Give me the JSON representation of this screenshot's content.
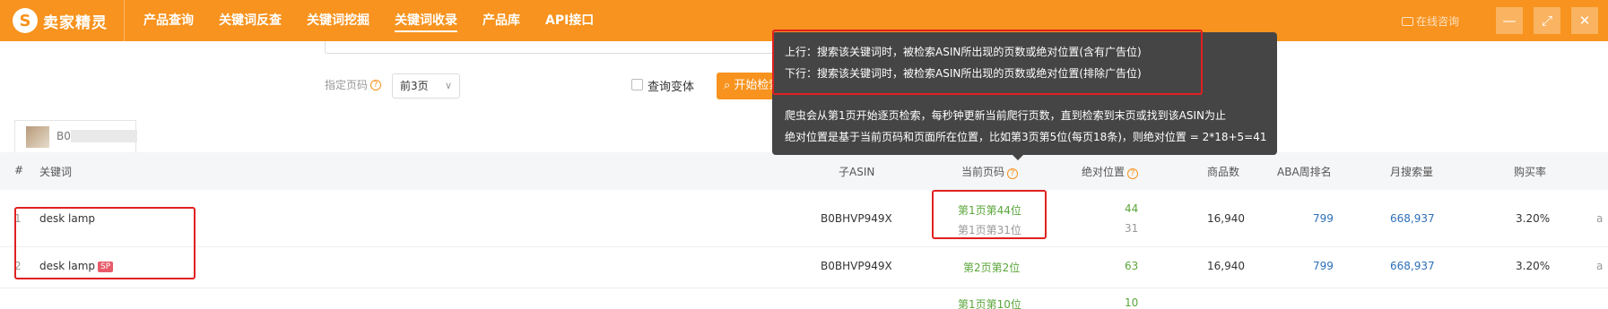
{
  "app": {
    "logo_mark": "S",
    "name": "卖家精灵"
  },
  "nav": [
    {
      "label": "产品查询"
    },
    {
      "label": "关键词反查"
    },
    {
      "label": "关键词挖掘"
    },
    {
      "label": "关键词收录",
      "active": true
    },
    {
      "label": "产品库"
    },
    {
      "label": "API接口"
    }
  ],
  "header": {
    "online": "在线咨询"
  },
  "controls": {
    "page_label": "指定页码",
    "page_select": "前3页",
    "variant_label": "查询变体",
    "start_button": "开始检索"
  },
  "tab": {
    "asin_prefix": "B0"
  },
  "table": {
    "headers": {
      "index": "#",
      "keyword": "关键词",
      "child_asin": "子ASIN",
      "current_page": "当前页码",
      "absolute_position": "绝对位置",
      "product_count": "商品数",
      "aba_rank": "ABA周排名",
      "monthly_search": "月搜索量",
      "purchase_rate": "购买率"
    },
    "rows": [
      {
        "index": "1",
        "keyword": "desk lamp",
        "sp": "",
        "asin": "B0BHVP949X",
        "page_top": "第1页第44位",
        "page_bottom": "第1页第31位",
        "abs_top": "44",
        "abs_bottom": "31",
        "products": "16,940",
        "aba": "799",
        "monthly": "668,937",
        "rate": "3.20%",
        "extra": "a"
      },
      {
        "index": "2",
        "keyword": "desk lamp",
        "sp": "SP",
        "asin": "B0BHVP949X",
        "page_top": "第2页第2位",
        "page_bottom": "",
        "abs_top": "63",
        "abs_bottom": "",
        "products": "16,940",
        "aba": "799",
        "monthly": "668,937",
        "rate": "3.20%",
        "extra": "a"
      },
      {
        "index": "",
        "keyword": "",
        "sp": "",
        "asin": "",
        "page_top": "第1页第10位",
        "page_bottom": "",
        "abs_top": "10",
        "abs_bottom": "",
        "products": "",
        "aba": "",
        "monthly": "",
        "rate": "",
        "extra": ""
      }
    ]
  },
  "tooltip": {
    "line1": "上行：搜索该关键词时，被检索ASIN所出现的页数或绝对位置(含有广告位)",
    "line2": "下行：搜索该关键词时，被检索ASIN所出现的页数或绝对位置(排除广告位)",
    "line3": "爬虫会从第1页开始逐页检索，每秒钟更新当前爬行页数，直到检索到末页或找到该ASIN为止",
    "line4": "绝对位置是基于当前页码和页面所在位置，比如第3页第5位(每页18条)，则绝对位置 = 2*18+5=41"
  },
  "colors": {
    "brand": "#f7931e",
    "green": "#5aa63a",
    "blue": "#2d6fb7",
    "annotation": "#e02020",
    "sp_badge": "#e85b6b"
  }
}
